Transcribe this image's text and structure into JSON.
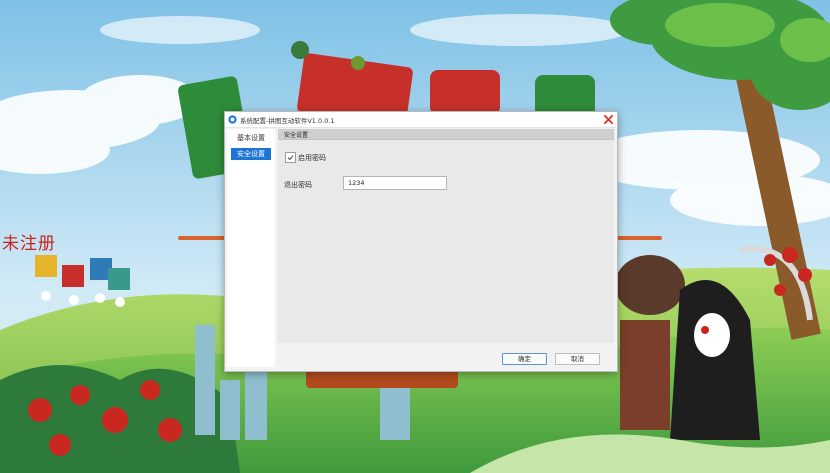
{
  "background": {
    "watermark_text": "未注册"
  },
  "dialog": {
    "title": "系统配置-拼图互动软件V1.0.0.1",
    "sidebar": {
      "items": [
        {
          "label": "基本设置",
          "active": false
        },
        {
          "label": "安全设置",
          "active": true
        }
      ]
    },
    "section_title": "安全设置",
    "enable_password_label": "启用密码",
    "enable_password_checked": true,
    "exit_password_label": "退出密码",
    "exit_password_value": "1234",
    "ok_label": "确定",
    "cancel_label": "取消"
  },
  "colors": {
    "accent": "#1b74d6",
    "close_red": "#e02f2f",
    "watermark_red": "#c7241c"
  }
}
